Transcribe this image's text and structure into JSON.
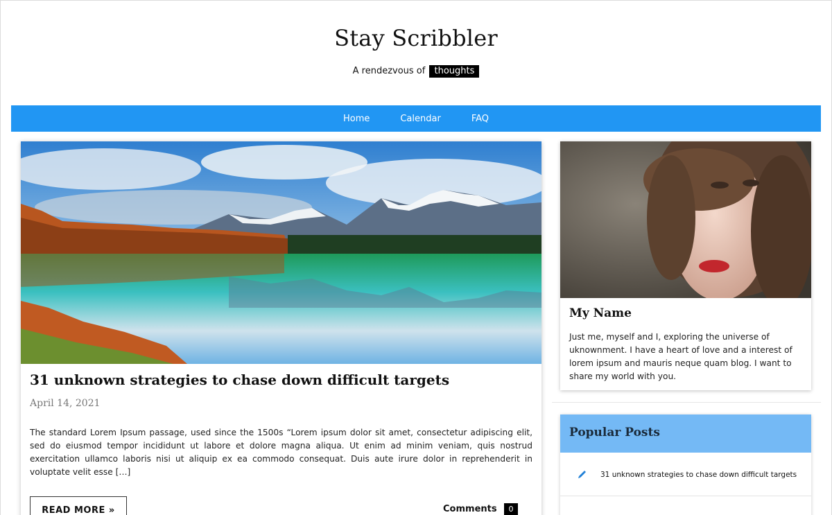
{
  "header": {
    "site_title": "Stay Scribbler",
    "tagline_prefix": "A rendezvous of",
    "tagline_highlight": "thoughts"
  },
  "nav": {
    "items": [
      {
        "label": "Home"
      },
      {
        "label": "Calendar"
      },
      {
        "label": "FAQ"
      }
    ],
    "color": "#2196f3"
  },
  "post": {
    "image_icon": "landscape-photo",
    "title": "31 unknown strategies to chase down difficult targets",
    "date": "April 14, 2021",
    "excerpt": "The standard Lorem Ipsum passage, used since the 1500s “Lorem ipsum dolor sit amet, consectetur adipiscing elit, sed do eiusmod tempor incididunt ut labore et dolore magna aliqua. Ut enim ad minim veniam, quis nostrud exercitation ullamco laboris nisi ut aliquip ex ea commodo consequat. Duis aute irure dolor in reprehenderit in voluptate velit esse […]",
    "read_more_label": "READ MORE »",
    "comments_label": "Comments",
    "comments_count": "0"
  },
  "profile": {
    "image_icon": "portrait-photo",
    "name": "My Name",
    "bio": "Just me, myself and I, exploring the universe of uknownment. I have a heart of love and a interest of lorem ipsum and mauris neque quam blog. I want to share my world with you."
  },
  "popular": {
    "title": "Popular Posts",
    "header_color": "#74b9f5",
    "items": [
      {
        "label": "31 unknown strategies to chase down difficult targets",
        "icon": "pencil-icon"
      }
    ]
  }
}
